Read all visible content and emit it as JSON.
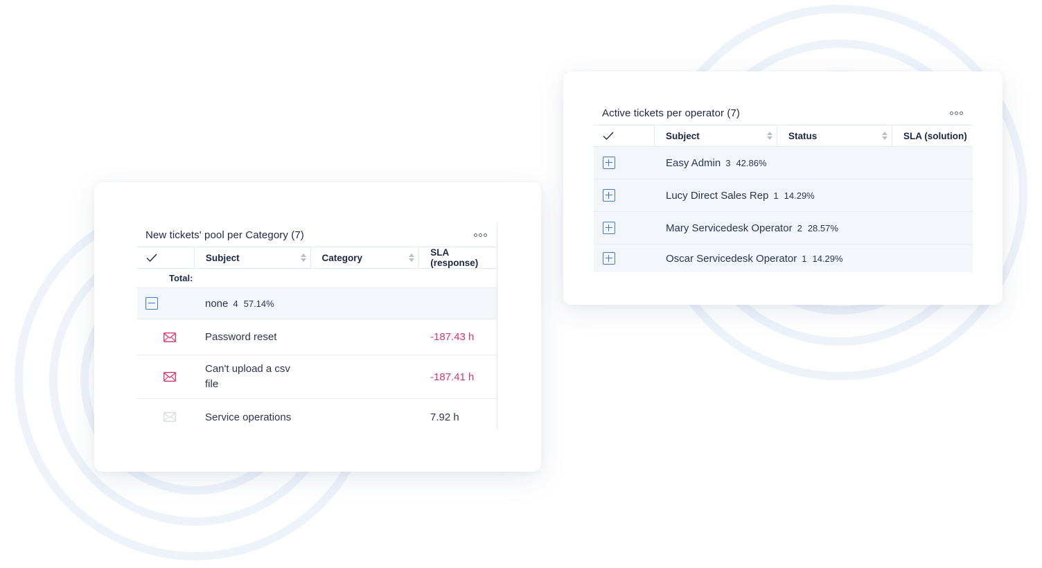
{
  "left_widget": {
    "title": "New tickets' pool per Category (7)",
    "columns": [
      "Subject",
      "Category",
      "SLA (response)"
    ],
    "total_label": "Total:",
    "group": {
      "name": "none",
      "count": "4",
      "percent": "57.14%"
    },
    "rows": [
      {
        "subject": "Password reset",
        "sla": "-187.43 h",
        "overdue": true
      },
      {
        "subject": "Can't upload a csv file",
        "sla": "-187.41 h",
        "overdue": true
      },
      {
        "subject": "Service operations",
        "sla": "7.92 h",
        "overdue": false
      }
    ]
  },
  "right_widget": {
    "title": "Active tickets per operator (7)",
    "columns": [
      "Subject",
      "Status",
      "SLA (solution)"
    ],
    "groups": [
      {
        "name": "Easy Admin",
        "count": "3",
        "percent": "42.86%"
      },
      {
        "name": "Lucy Direct Sales Rep",
        "count": "1",
        "percent": "14.29%"
      },
      {
        "name": "Mary Servicedesk Operator",
        "count": "2",
        "percent": "28.57%"
      },
      {
        "name": "Oscar Servicedesk Operator",
        "count": "1",
        "percent": "14.29%"
      }
    ]
  },
  "colors": {
    "accent": "#3d7bc6",
    "overdue": "#d8356b",
    "text": "#1c2746",
    "group_bg": "#f3f6fa"
  },
  "icons": [
    "check-icon",
    "sort-icon",
    "more-icon",
    "collapse-icon",
    "expand-icon",
    "mail-icon"
  ]
}
